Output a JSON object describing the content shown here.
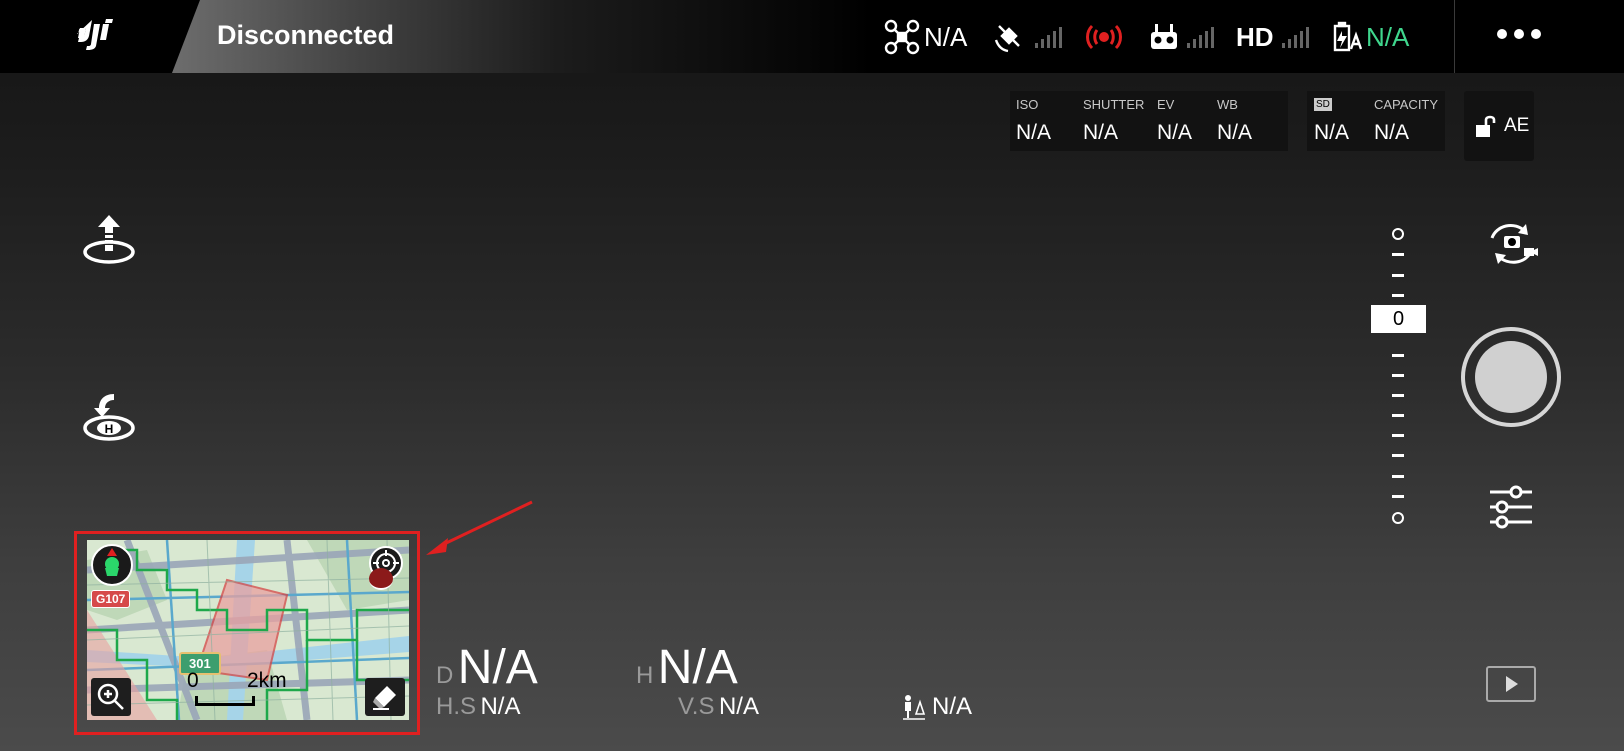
{
  "topbar": {
    "brand_icon": "dji-logo",
    "status": "Disconnected",
    "aircraft_label": "N/A",
    "gps_icon": "satellite-icon",
    "obstacle_icon": "radar-icon",
    "remote_icon": "remote-controller-icon",
    "hd_label": "HD",
    "battery_label": "N/A",
    "more_icon": "more-icon",
    "colors": {
      "battery_value": "#3fd68d",
      "obstacle": "#e02020"
    }
  },
  "camera": {
    "iso_label": "ISO",
    "iso_value": "N/A",
    "shutter_label": "SHUTTER",
    "shutter_value": "N/A",
    "ev_label": "EV",
    "ev_value": "N/A",
    "wb_label": "WB",
    "wb_value": "N/A",
    "sd_label": "SD",
    "sd_value": "N/A",
    "capacity_label": "CAPACITY",
    "capacity_value": "N/A",
    "ae_label": "AE"
  },
  "slider": {
    "value": "0"
  },
  "map": {
    "road_label_1": "G107",
    "road_label_2": "301",
    "scale_zero": "0",
    "scale_distance": "2km"
  },
  "telemetry": {
    "d_label": "D",
    "d_value": "N/A",
    "h_label": "H",
    "h_value": "N/A",
    "hs_label": "H.S",
    "hs_value": "N/A",
    "vs_label": "V.S",
    "vs_value": "N/A",
    "vps_value": "N/A"
  }
}
